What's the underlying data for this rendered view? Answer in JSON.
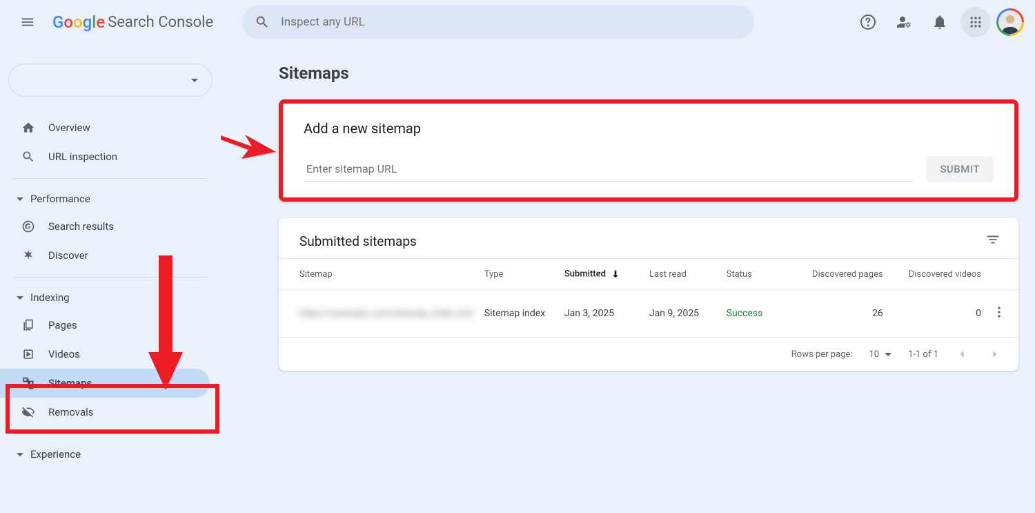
{
  "header": {
    "logo_text": "Search Console",
    "search_placeholder": "Inspect any URL"
  },
  "sidebar": {
    "overview": "Overview",
    "url_inspection": "URL inspection",
    "section_performance": "Performance",
    "search_results": "Search results",
    "discover": "Discover",
    "section_indexing": "Indexing",
    "pages": "Pages",
    "videos": "Videos",
    "sitemaps": "Sitemaps",
    "removals": "Removals",
    "section_experience": "Experience"
  },
  "main": {
    "title": "Sitemaps",
    "add_card": {
      "title": "Add a new sitemap",
      "placeholder": "Enter sitemap URL",
      "submit": "SUBMIT"
    },
    "submitted": {
      "title": "Submitted sitemaps",
      "columns": {
        "sitemap": "Sitemap",
        "type": "Type",
        "submitted": "Submitted",
        "last_read": "Last read",
        "status": "Status",
        "disc_pages": "Discovered pages",
        "disc_videos": "Discovered videos"
      },
      "row": {
        "sitemap": "https://example.com/sitemap_index.xml",
        "type": "Sitemap index",
        "submitted": "Jan 3, 2025",
        "last_read": "Jan 9, 2025",
        "status": "Success",
        "pages": "26",
        "videos": "0"
      },
      "footer": {
        "rows_label": "Rows per page:",
        "rows_value": "10",
        "range": "1-1 of 1"
      }
    }
  }
}
